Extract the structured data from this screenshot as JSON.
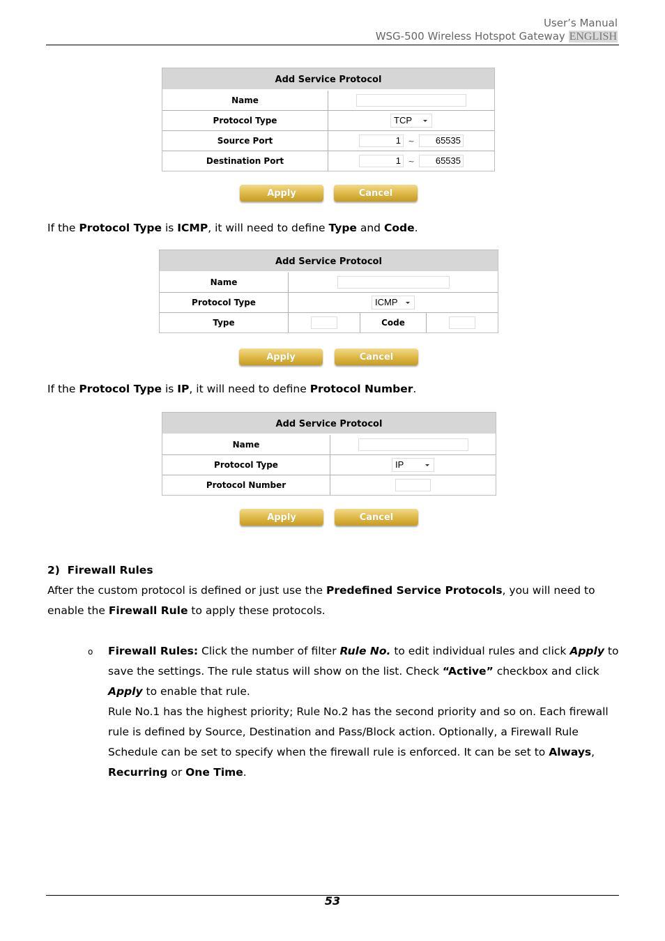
{
  "header": {
    "line1": "User’s Manual",
    "line2": "WSG-500 Wireless Hotspot Gateway",
    "language": "ENGLISH"
  },
  "panel_tcp": {
    "title": "Add Service Protocol",
    "name_label": "Name",
    "name_value": "",
    "protocol_type_label": "Protocol Type",
    "protocol_type_value": "TCP",
    "source_port_label": "Source Port",
    "source_port_from": "1",
    "source_port_to": "65535",
    "destination_port_label": "Destination Port",
    "destination_port_from": "1",
    "destination_port_to": "65535",
    "range_separator": "~",
    "apply_label": "Apply",
    "cancel_label": "Cancel"
  },
  "text_icmp": {
    "t1": "If the ",
    "b1": "Protocol Type",
    "t2": " is ",
    "b2": "ICMP",
    "t3": ", it will need to define ",
    "b3": "Type",
    "t4": " and ",
    "b4": "Code",
    "t5": "."
  },
  "panel_icmp": {
    "title": "Add Service Protocol",
    "name_label": "Name",
    "name_value": "",
    "protocol_type_label": "Protocol Type",
    "protocol_type_value": "ICMP",
    "type_label": "Type",
    "type_value": "",
    "code_label": "Code",
    "code_value": "",
    "apply_label": "Apply",
    "cancel_label": "Cancel"
  },
  "text_ip": {
    "t1": "If the ",
    "b1": "Protocol Type",
    "t2": " is ",
    "b2": "IP",
    "t3": ", it will need to define ",
    "b3": "Protocol Number",
    "t4": "."
  },
  "panel_ip": {
    "title": "Add Service Protocol",
    "name_label": "Name",
    "name_value": "",
    "protocol_type_label": "Protocol Type",
    "protocol_type_value": "IP",
    "protocol_number_label": "Protocol Number",
    "protocol_number_value": "",
    "apply_label": "Apply",
    "cancel_label": "Cancel"
  },
  "section": {
    "heading": "2)  Firewall Rules",
    "p1_t1": "After the custom protocol is defined or just use the ",
    "p1_b1": "Predefined Service Protocols",
    "p1_t2": ", you will need to enable the ",
    "p1_b2": "Firewall Rule",
    "p1_t3": " to apply these protocols."
  },
  "bullet": {
    "marker": "o",
    "b1": "Firewall Rules:",
    "t1": " Click the number of filter ",
    "bi1": "Rule No.",
    "t2": " to edit individual rules and click ",
    "bi2": "Apply",
    "t3": " to save the settings. The rule status will show on the list. Check ",
    "b2": "“Active”",
    "t4": " checkbox and click ",
    "bi3": "Apply",
    "t5": " to enable that rule.",
    "p2_t1": "Rule No.1 has the highest priority; Rule No.2 has the second priority and so on. Each firewall rule is defined by Source, Destination and Pass/Block action. Optionally, a Firewall Rule Schedule can be set to specify when the firewall rule is enforced. It can be set to ",
    "p2_b1": "Always",
    "p2_t2": ", ",
    "p2_b2": "Recurring",
    "p2_t3": " or ",
    "p2_b3": "One Time",
    "p2_t4": "."
  },
  "footer": {
    "page_number": "53"
  }
}
